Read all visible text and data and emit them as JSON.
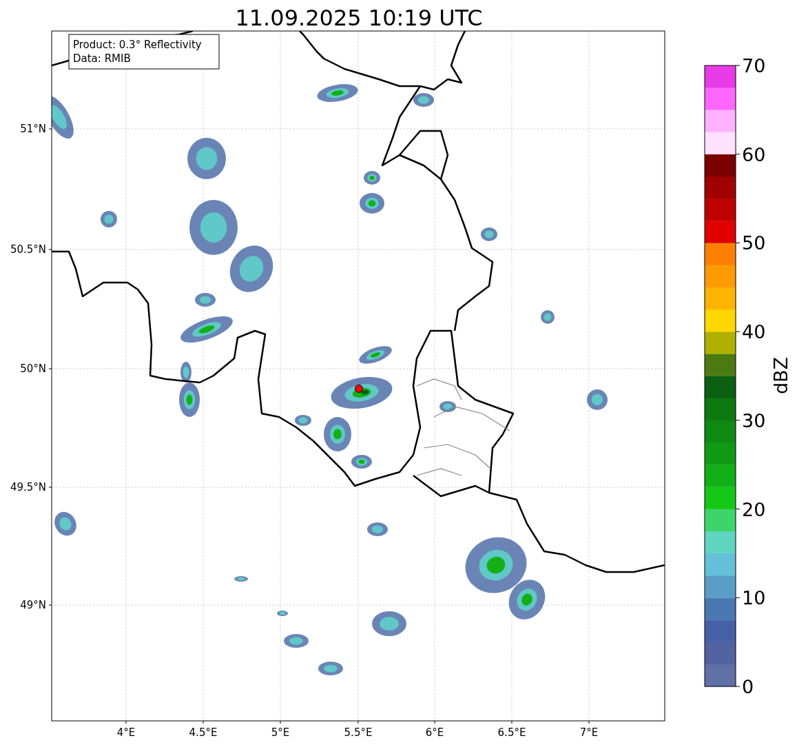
{
  "title": "11.09.2025 10:19 UTC",
  "map": {
    "info_box": [
      "Product: 0.3° Reflectivity",
      "Data: RMIB"
    ],
    "lat_ticks": [
      "51°N",
      "50.5°N",
      "50°N",
      "49.5°N",
      "49°N"
    ],
    "lon_ticks": [
      "4°E",
      "4.5°E",
      "5°E",
      "5.5°E",
      "6°E",
      "6.5°E",
      "7°E"
    ]
  },
  "colorbar": {
    "label": "dBZ",
    "ticks": [
      "70",
      "60",
      "50",
      "40",
      "30",
      "20",
      "10",
      "0"
    ],
    "segments": [
      {
        "color": "#6270a8"
      },
      {
        "color": "#5262a0"
      },
      {
        "color": "#4660a8"
      },
      {
        "color": "#4a78b0"
      },
      {
        "color": "#5a9ec8"
      },
      {
        "color": "#64c0d8"
      },
      {
        "color": "#60d6c0"
      },
      {
        "color": "#3ed46a"
      },
      {
        "color": "#14c818"
      },
      {
        "color": "#12b016"
      },
      {
        "color": "#109a14"
      },
      {
        "color": "#0e8a12"
      },
      {
        "color": "#0c7a10"
      },
      {
        "color": "#0a6010"
      },
      {
        "color": "#4a7a10"
      },
      {
        "color": "#b0b000"
      },
      {
        "color": "#ffd700"
      },
      {
        "color": "#ffb400"
      },
      {
        "color": "#ff9a00"
      },
      {
        "color": "#ff7f00"
      },
      {
        "color": "#e00000"
      },
      {
        "color": "#c00000"
      },
      {
        "color": "#a00000"
      },
      {
        "color": "#7a0000"
      },
      {
        "color": "#ffe0ff"
      },
      {
        "color": "#ffb3ff"
      },
      {
        "color": "#ff66ff"
      },
      {
        "color": "#e83be8"
      }
    ]
  }
}
